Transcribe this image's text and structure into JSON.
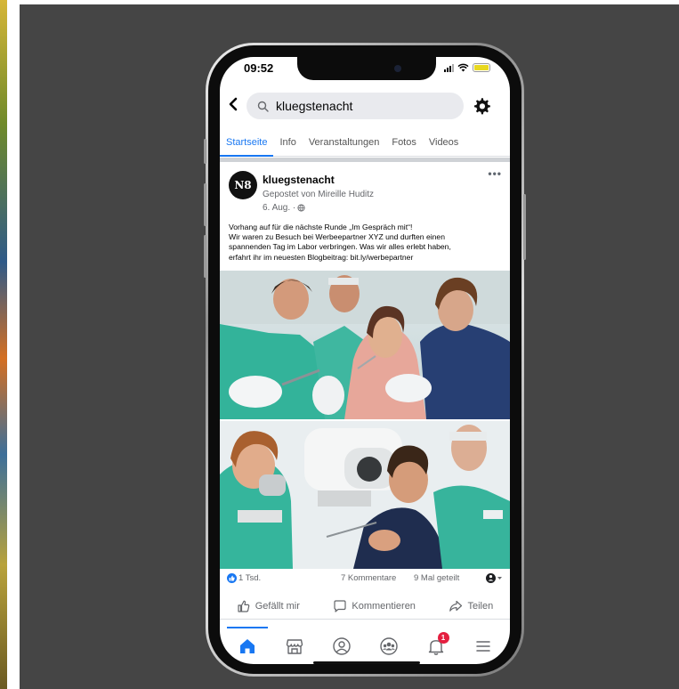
{
  "status_bar": {
    "time": "09:52"
  },
  "search": {
    "query": "kluegstenacht"
  },
  "tabs": [
    {
      "label": "Startseite",
      "active": true
    },
    {
      "label": "Info",
      "active": false
    },
    {
      "label": "Veranstaltungen",
      "active": false
    },
    {
      "label": "Fotos",
      "active": false
    },
    {
      "label": "Videos",
      "active": false
    }
  ],
  "post": {
    "avatar_text": "N8",
    "page_name": "kluegstenacht",
    "posted_by": "Gepostet von Mireille Huditz",
    "date": "6. Aug. · ",
    "more": "•••",
    "text_lines": [
      "Vorhang auf für die nächste Runde „Im Gespräch mit“!",
      "Wir waren zu Besuch bei Werbeepartner XYZ und durften einen",
      "spannenden Tag im Labor verbringen. Was wir alles erlebt haben,",
      "erfahrt ihr im neuesten Blogbeitrag: bit.ly/werbepartner"
    ]
  },
  "reactions": {
    "likes": "1 Tsd.",
    "comments": "7 Kommentare",
    "shares": "9 Mal geteilt"
  },
  "actions": {
    "like": "Gefällt mir",
    "comment": "Kommentieren",
    "share": "Teilen"
  },
  "notifications_badge": "1",
  "colors": {
    "accent": "#1877f2",
    "backdrop": "#454545",
    "badge": "#e41e3f"
  }
}
